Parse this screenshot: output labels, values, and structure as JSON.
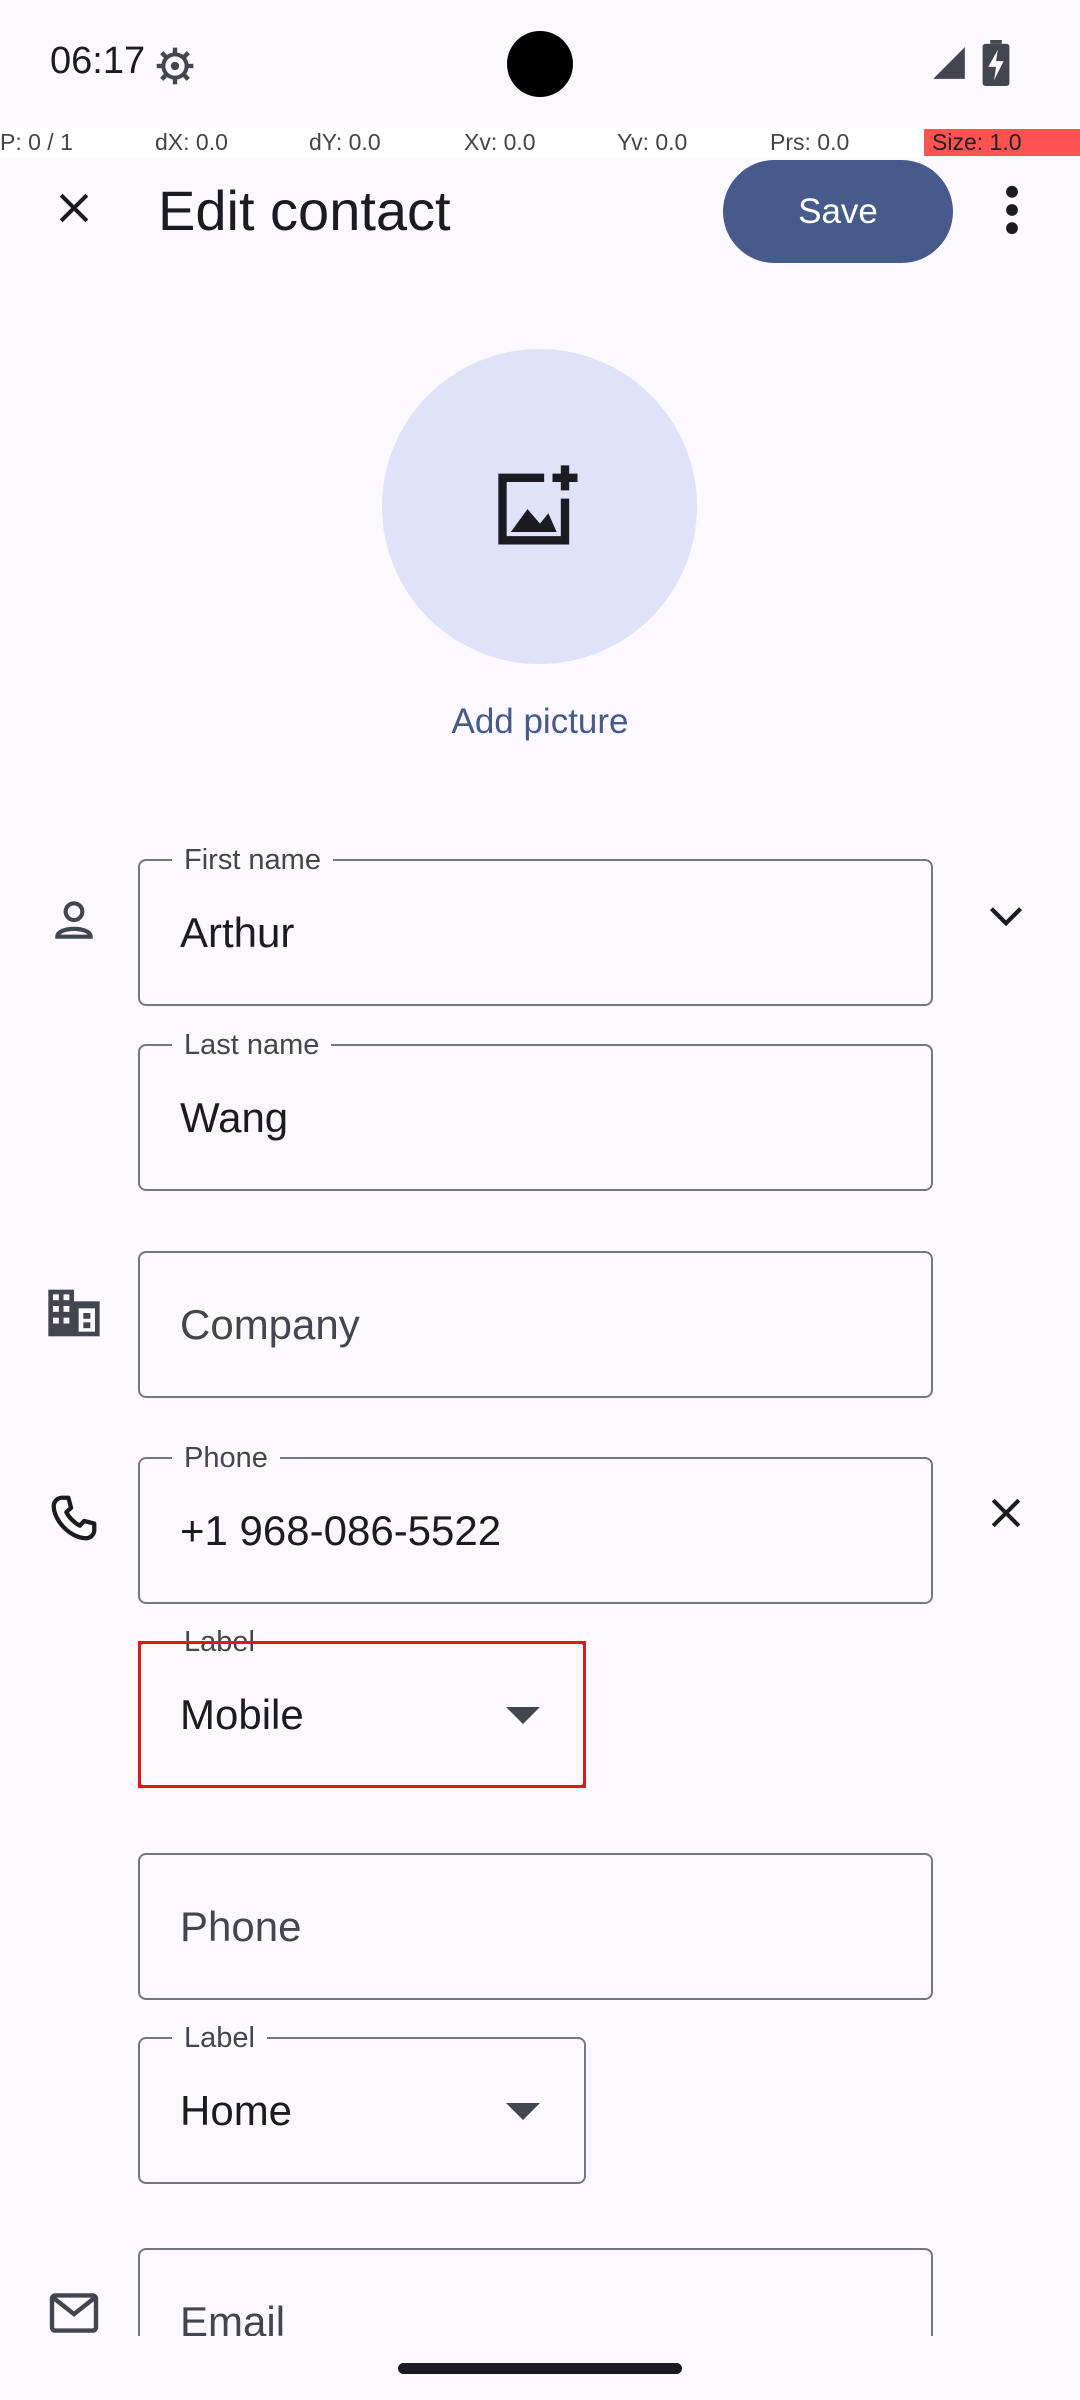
{
  "status_bar": {
    "time": "06:17"
  },
  "debug_overlay": {
    "pointer": "P: 0 / 1",
    "dx": "dX: 0.0",
    "dy": "dY: 0.0",
    "xv": "Xv: 0.0",
    "yv": "Yv: 0.0",
    "prs": "Prs: 0.0",
    "size": "Size: 1.0"
  },
  "app_bar": {
    "title": "Edit contact",
    "save_label": "Save",
    "close_icon": "close-icon",
    "more_icon": "more-vert-icon"
  },
  "avatar": {
    "add_picture_label": "Add picture",
    "icon": "add-photo-icon"
  },
  "form": {
    "first_name": {
      "label": "First name",
      "value": "Arthur"
    },
    "last_name": {
      "label": "Last name",
      "value": "Wang"
    },
    "company": {
      "placeholder": "Company"
    },
    "phone1": {
      "label": "Phone",
      "value": "+1 968-086-5522"
    },
    "phone1_label": {
      "label": "Label",
      "value": "Mobile"
    },
    "phone2": {
      "placeholder": "Phone"
    },
    "phone2_label": {
      "label": "Label",
      "value": "Home"
    },
    "email": {
      "placeholder": "Email"
    }
  },
  "colors": {
    "accent": "#465a8c",
    "background": "#fcf8ff",
    "avatar_bg": "#dfe2f8",
    "highlight": "#e01818"
  }
}
